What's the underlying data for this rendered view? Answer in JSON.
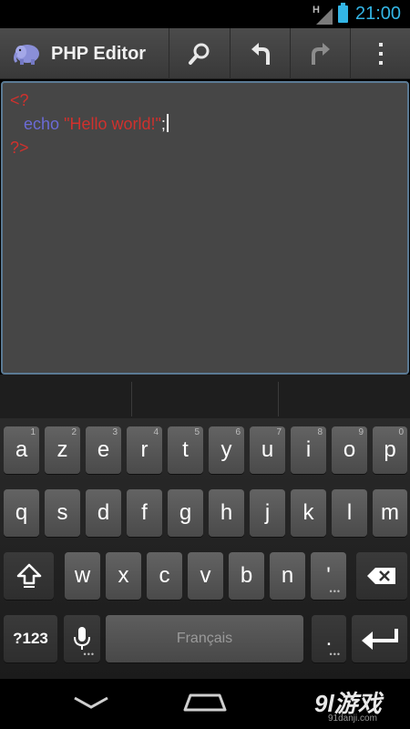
{
  "status_bar": {
    "network": "H",
    "time": "21:00",
    "accent": "#33b5e5"
  },
  "action_bar": {
    "app_icon": "php-elephant-icon",
    "title": "PHP Editor",
    "actions": [
      "search-icon",
      "undo-icon",
      "redo-icon",
      "overflow-menu-icon"
    ]
  },
  "editor": {
    "line1": "<?",
    "line2_indent": "   ",
    "line2_keyword": "echo",
    "line2_space": " ",
    "line2_string": "\"Hello world!\"",
    "line2_end": ";",
    "line3": "?>",
    "colors": {
      "tag": "#d0312d",
      "keyword": "#6b6bd6",
      "border": "#5b7a94"
    }
  },
  "keyboard": {
    "row1": [
      {
        "label": "a",
        "hint": "1"
      },
      {
        "label": "z",
        "hint": "2"
      },
      {
        "label": "e",
        "hint": "3"
      },
      {
        "label": "r",
        "hint": "4"
      },
      {
        "label": "t",
        "hint": "5"
      },
      {
        "label": "y",
        "hint": "6"
      },
      {
        "label": "u",
        "hint": "7"
      },
      {
        "label": "i",
        "hint": "8"
      },
      {
        "label": "o",
        "hint": "9"
      },
      {
        "label": "p",
        "hint": "0"
      }
    ],
    "row2": [
      "q",
      "s",
      "d",
      "f",
      "g",
      "h",
      "j",
      "k",
      "l",
      "m"
    ],
    "row3": [
      "w",
      "x",
      "c",
      "v",
      "b",
      "n",
      "'"
    ],
    "symbols_label": "?123",
    "space_label": "Français",
    "period_label": ".",
    "more_dots": "•••"
  },
  "nav_bar": {
    "watermark": "9l游戏",
    "watermark_sub": "91danji.com"
  }
}
